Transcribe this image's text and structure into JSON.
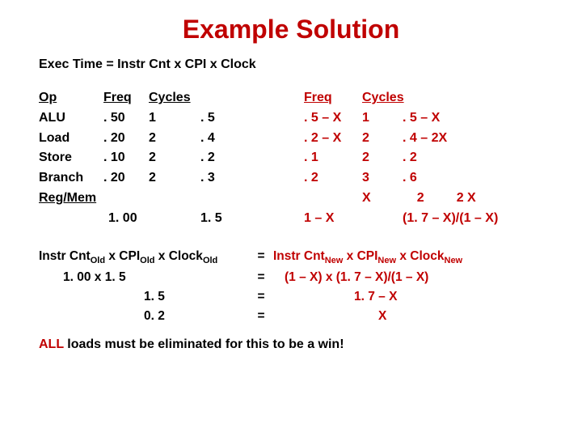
{
  "title": "Example Solution",
  "formula": "Exec Time = Instr Cnt  x CPI x Clock",
  "headers": {
    "op": "Op",
    "freq": "Freq",
    "cycles": "Cycles",
    "freq2": "Freq",
    "cycles2": "Cycles"
  },
  "rows": [
    {
      "op": "ALU",
      "freq": ". 50",
      "cyc": "1",
      "prod": ". 5",
      "freq2": ". 5 – X",
      "cyc2": "1",
      "prod2": ". 5 – X"
    },
    {
      "op": "Load",
      "freq": ". 20",
      "cyc": "2",
      "prod": ". 4",
      "freq2": ". 2 – X",
      "cyc2": "2",
      "prod2": ". 4 – 2X"
    },
    {
      "op": "Store",
      "freq": ". 10",
      "cyc": "2",
      "prod": ". 2",
      "freq2": ". 1",
      "cyc2": "2",
      "prod2": ". 2"
    },
    {
      "op": "Branch",
      "freq": ". 20",
      "cyc": "2",
      "prod": ". 3",
      "freq2": ". 2",
      "cyc2": "3",
      "prod2": ". 6"
    }
  ],
  "regmem": {
    "label": "Reg/Mem",
    "cyc2": "X",
    "prod2": "2",
    "extra": "2 X"
  },
  "totals": {
    "freq": "1. 00",
    "prod": "1. 5",
    "freq2": "1 – X",
    "prod2": "(1. 7 – X)/(1 – X)"
  },
  "eq": {
    "line1_l_parts": [
      "Instr Cnt",
      "Old",
      " x CPI",
      "Old",
      " x Clock",
      "Old"
    ],
    "line1_r_parts": [
      "Instr Cnt",
      "New",
      " x CPI",
      "New",
      " x Clock",
      "New"
    ],
    "l2_l": "1. 00          x  1. 5",
    "l2_r": "(1 – X)        x (1. 7 – X)/(1 – X)",
    "l3_l": "1. 5",
    "l3_r": "1. 7 – X",
    "l4_l": "0. 2",
    "l4_r": "X",
    "eq": "="
  },
  "conclusion_strong": "ALL",
  "conclusion_rest": " loads must be eliminated for this to be a win!"
}
